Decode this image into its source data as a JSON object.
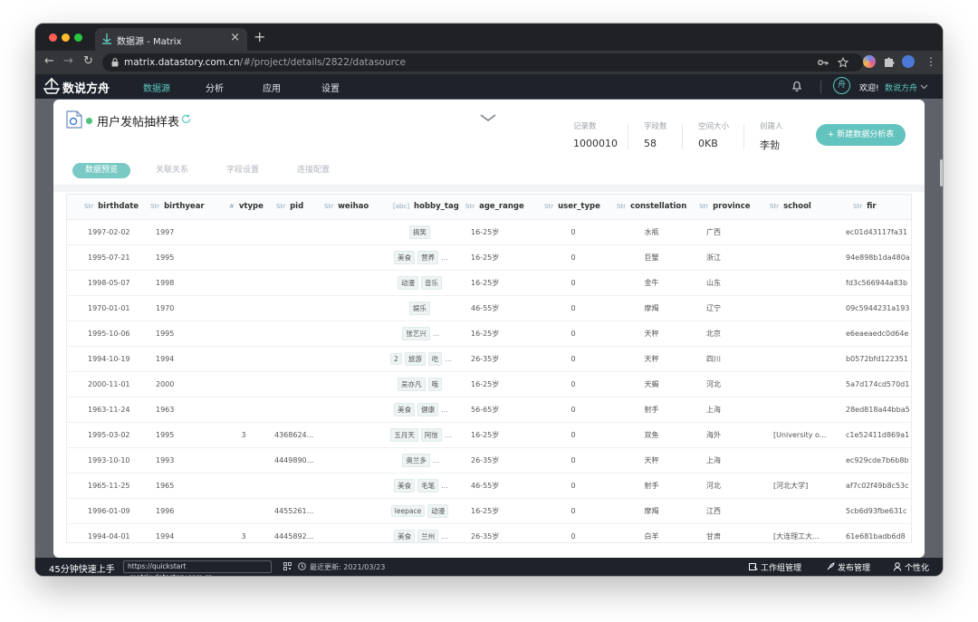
{
  "browser": {
    "tab_title": "数据源 - Matrix",
    "tab_close": "×",
    "new_tab": "+",
    "url_host": "matrix.datastory.com.cn",
    "url_path": "/#/project/details/2822/datasource",
    "back": "←",
    "forward": "→",
    "reload": "↻"
  },
  "app": {
    "logo": "数说方舟",
    "nav": [
      "数据源",
      "分析",
      "应用",
      "设置"
    ],
    "avatar": "舟",
    "welcome": "欢迎!",
    "username": "数说方舟"
  },
  "dataset": {
    "title": "用户发帖抽样表",
    "stats": [
      {
        "label": "记录数",
        "value": "1000010"
      },
      {
        "label": "字段数",
        "value": "58"
      },
      {
        "label": "空间大小",
        "value": "0KB"
      },
      {
        "label": "创建人",
        "value": "李勃"
      }
    ],
    "create_button": "+ 新建数据分析表",
    "tabs": [
      "数据预览",
      "关联关系",
      "字段设置",
      "连接配置"
    ]
  },
  "table": {
    "columns": [
      {
        "type": "Str",
        "name": "birthdate"
      },
      {
        "type": "Str",
        "name": "birthyear"
      },
      {
        "type": "#",
        "name": "vtype"
      },
      {
        "type": "Str",
        "name": "pid"
      },
      {
        "type": "Str",
        "name": "weihao"
      },
      {
        "type": "[abc]",
        "name": "hobby_tag"
      },
      {
        "type": "Str",
        "name": "age_range"
      },
      {
        "type": "Str",
        "name": "user_type"
      },
      {
        "type": "Str",
        "name": "constellation"
      },
      {
        "type": "Str",
        "name": "province"
      },
      {
        "type": "Str",
        "name": "school"
      },
      {
        "type": "Str",
        "name": "fir"
      }
    ],
    "rows": [
      {
        "birthdate": "1997-02-02",
        "birthyear": "1997",
        "vtype": "",
        "pid": "",
        "weihao": "",
        "tags": [
          "搞笑"
        ],
        "more": false,
        "age_range": "16-25岁",
        "user_type": "0",
        "constellation": "水瓶",
        "province": "广西",
        "school": "",
        "fir": "ec01d43117fa31"
      },
      {
        "birthdate": "1995-07-21",
        "birthyear": "1995",
        "vtype": "",
        "pid": "",
        "weihao": "",
        "tags": [
          "美食",
          "营养"
        ],
        "more": true,
        "age_range": "16-25岁",
        "user_type": "0",
        "constellation": "巨蟹",
        "province": "浙江",
        "school": "",
        "fir": "94e898b1da480a"
      },
      {
        "birthdate": "1998-05-07",
        "birthyear": "1998",
        "vtype": "",
        "pid": "",
        "weihao": "",
        "tags": [
          "动漫",
          "音乐"
        ],
        "more": false,
        "age_range": "16-25岁",
        "user_type": "0",
        "constellation": "金牛",
        "province": "山东",
        "school": "",
        "fir": "fd3c566944a83b"
      },
      {
        "birthdate": "1970-01-01",
        "birthyear": "1970",
        "vtype": "",
        "pid": "",
        "weihao": "",
        "tags": [
          "娱乐"
        ],
        "more": false,
        "age_range": "46-55岁",
        "user_type": "0",
        "constellation": "摩羯",
        "province": "辽宁",
        "school": "",
        "fir": "09c5944231a193"
      },
      {
        "birthdate": "1995-10-06",
        "birthyear": "1995",
        "vtype": "",
        "pid": "",
        "weihao": "",
        "tags": [
          "张艺兴"
        ],
        "more": true,
        "age_range": "16-25岁",
        "user_type": "0",
        "constellation": "天秤",
        "province": "北京",
        "school": "",
        "fir": "e6eaeaedc0d64e"
      },
      {
        "birthdate": "1994-10-19",
        "birthyear": "1994",
        "vtype": "",
        "pid": "",
        "weihao": "",
        "tags": [
          "2",
          "旅游",
          "吃"
        ],
        "more": true,
        "age_range": "26-35岁",
        "user_type": "0",
        "constellation": "天秤",
        "province": "四川",
        "school": "",
        "fir": "b0572bfd122351"
      },
      {
        "birthdate": "2000-11-01",
        "birthyear": "2000",
        "vtype": "",
        "pid": "",
        "weihao": "",
        "tags": [
          "吴亦凡",
          "哦"
        ],
        "more": false,
        "age_range": "16-25岁",
        "user_type": "0",
        "constellation": "天蝎",
        "province": "河北",
        "school": "",
        "fir": "5a7d174cd570d1"
      },
      {
        "birthdate": "1963-11-24",
        "birthyear": "1963",
        "vtype": "",
        "pid": "",
        "weihao": "",
        "tags": [
          "美食",
          "健康"
        ],
        "more": true,
        "age_range": "56-65岁",
        "user_type": "0",
        "constellation": "射手",
        "province": "上海",
        "school": "",
        "fir": "28ed818a44bba5"
      },
      {
        "birthdate": "1995-03-02",
        "birthyear": "1995",
        "vtype": "3",
        "pid": "4368624...",
        "weihao": "",
        "tags": [
          "五月天",
          "阿信"
        ],
        "more": true,
        "age_range": "16-25岁",
        "user_type": "0",
        "constellation": "双鱼",
        "province": "海外",
        "school": "[University o...",
        "fir": "c1e52411d869a1"
      },
      {
        "birthdate": "1993-10-10",
        "birthyear": "1993",
        "vtype": "",
        "pid": "4449890...",
        "weihao": "",
        "tags": [
          "奥兰多"
        ],
        "more": true,
        "age_range": "26-35岁",
        "user_type": "0",
        "constellation": "天秤",
        "province": "上海",
        "school": "",
        "fir": "ec929cde7b6b8b"
      },
      {
        "birthdate": "1965-11-25",
        "birthyear": "1965",
        "vtype": "",
        "pid": "",
        "weihao": "",
        "tags": [
          "美食",
          "毛笔"
        ],
        "more": true,
        "age_range": "46-55岁",
        "user_type": "0",
        "constellation": "射手",
        "province": "河北",
        "school": "[河北大学]",
        "fir": "af7c02f49b8c53c"
      },
      {
        "birthdate": "1996-01-09",
        "birthyear": "1996",
        "vtype": "",
        "pid": "4455261...",
        "weihao": "",
        "tags": [
          "leepace",
          "动漫"
        ],
        "more": false,
        "age_range": "16-25岁",
        "user_type": "0",
        "constellation": "摩羯",
        "province": "江西",
        "school": "",
        "fir": "5cb6d93fbe631c"
      },
      {
        "birthdate": "1994-04-01",
        "birthyear": "1994",
        "vtype": "3",
        "pid": "4445892...",
        "weihao": "",
        "tags": [
          "美食",
          "兰州"
        ],
        "more": true,
        "age_range": "26-35岁",
        "user_type": "0",
        "constellation": "白羊",
        "province": "甘肃",
        "school": "[大连理工大...",
        "fir": "61e681badb6d8"
      }
    ]
  },
  "bottom": {
    "quickstart": "45分钟快速上手",
    "quickstart_url": "https://quickstart .matrix.datastory.com.cn",
    "last_update": "最近更新: 2021/03/23",
    "items": [
      "工作组管理",
      "发布管理",
      "个性化"
    ]
  },
  "colors": {
    "accent": "#5ec9c0",
    "button": "#63c3be",
    "status": "#4fc17a"
  }
}
